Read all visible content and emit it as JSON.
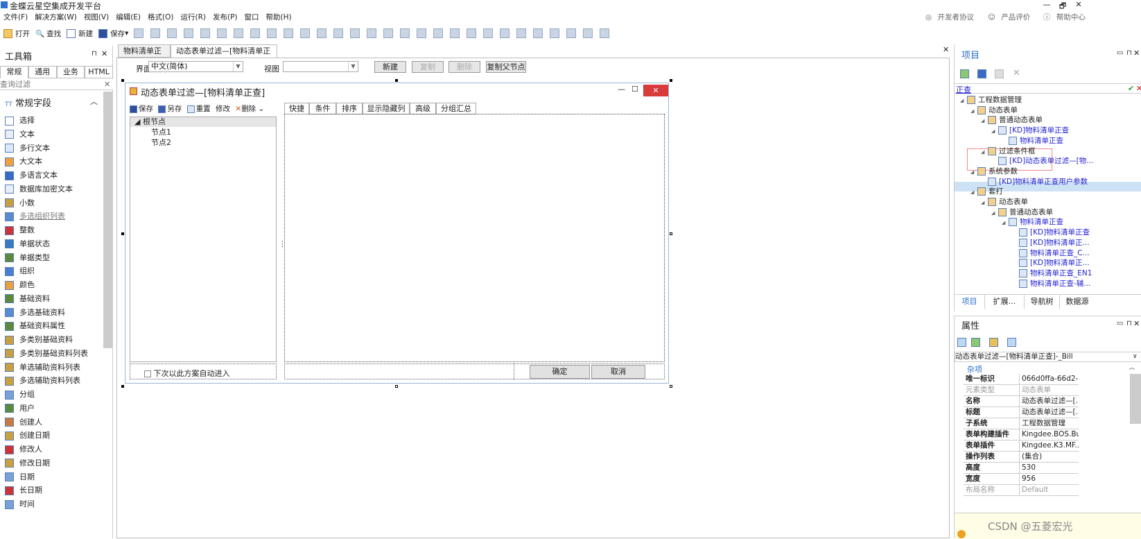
{
  "app": {
    "title": "金蝶云星空集成开发平台",
    "window_controls": [
      "—",
      "🗗",
      "✕"
    ]
  },
  "menu": {
    "items": [
      "文件(F)",
      "解决方案(W)",
      "视图(V)",
      "编辑(E)",
      "格式(O)",
      "运行(R)",
      "发布(P)",
      "窗口",
      "帮助(H)"
    ],
    "right": [
      "开发者协议",
      "产品评价",
      "帮助中心"
    ]
  },
  "toolbar": {
    "open": "打开",
    "find": "查找",
    "new": "新建",
    "save": "保存"
  },
  "toolbox": {
    "title": "工具箱",
    "tabs": [
      "常规",
      "通用",
      "业务",
      "HTML"
    ],
    "filter_placeholder": "查询过滤",
    "section": "常规字段",
    "items": [
      "选择",
      "文本",
      "多行文本",
      "大文本",
      "多语言文本",
      "数据库加密文本",
      "小数",
      "多选组织列表",
      "整数",
      "单据状态",
      "单据类型",
      "组织",
      "颜色",
      "基础资料",
      "多选基础资料",
      "基础资料属性",
      "多类别基础资料",
      "多类别基础资料列表",
      "单选辅助资料列表",
      "多选辅助资料列表",
      "分组",
      "用户",
      "创建人",
      "创建日期",
      "修改人",
      "修改日期",
      "日期",
      "长日期",
      "时间"
    ]
  },
  "doc_tabs": [
    "物料清单正查",
    "动态表单过滤—[物料清单正查]"
  ],
  "designer_bar": {
    "lang_label": "界面语言",
    "lang_value": "中文(简体)",
    "view_label": "视图",
    "view_value": "",
    "new": "新建",
    "copy": "复制",
    "delete": "删除",
    "copy_parent": "复制父节点"
  },
  "form": {
    "title": "动态表单过滤—[物料清单正查]",
    "toolbar": [
      "保存",
      "另存",
      "重置",
      "修改",
      "删除"
    ],
    "tree": {
      "root": "根节点",
      "children": [
        "节点1",
        "节点2"
      ]
    },
    "auto_enter": "下次以此方案自动进入",
    "tabs": [
      "快捷",
      "条件",
      "排序",
      "显示隐藏列",
      "高级",
      "分组汇总"
    ],
    "ok": "确定",
    "cancel": "取消"
  },
  "project": {
    "title": "项目",
    "filter": "正查",
    "tree": [
      {
        "label": "工程数据管理",
        "level": 0,
        "blue": false
      },
      {
        "label": "动态表单",
        "level": 1,
        "blue": false
      },
      {
        "label": "普通动态表单",
        "level": 2,
        "blue": false
      },
      {
        "label": "[KD]物料清单正查",
        "level": 3,
        "blue": true
      },
      {
        "label": "物料清单正查",
        "level": 4,
        "blue": true
      },
      {
        "label": "过滤条件框",
        "level": 2,
        "blue": false
      },
      {
        "label": "[KD]动态表单过滤—[物...",
        "level": 3,
        "blue": true
      },
      {
        "label": "系统参数",
        "level": 1,
        "blue": false
      },
      {
        "label": "[KD]物料清单正查用户参数",
        "level": 2,
        "blue": true
      },
      {
        "label": "套打",
        "level": 1,
        "blue": false,
        "selected": true
      },
      {
        "label": "动态表单",
        "level": 2,
        "blue": false
      },
      {
        "label": "普通动态表单",
        "level": 3,
        "blue": false
      },
      {
        "label": "物料清单正查",
        "level": 4,
        "blue": true
      },
      {
        "label": "[KD]物料清单正查",
        "level": 5,
        "blue": true
      },
      {
        "label": "[KD]物料清单正...",
        "level": 5,
        "blue": true
      },
      {
        "label": "物料清单正查_C...",
        "level": 5,
        "blue": true
      },
      {
        "label": "[KD]物料清单正...",
        "level": 5,
        "blue": true
      },
      {
        "label": "物料清单正查_EN1",
        "level": 5,
        "blue": true
      },
      {
        "label": "物料清单正查-辅...",
        "level": 5,
        "blue": true
      }
    ],
    "bottom_tabs": [
      "项目",
      "扩展...",
      "导航树",
      "数据源"
    ]
  },
  "properties": {
    "title": "属性",
    "object": "动态表单过滤—[物料清单正查]-_Bill",
    "category": "杂项",
    "rows": [
      {
        "k": "唯一标识",
        "v": "066d0ffa-66d2-...",
        "gray": false
      },
      {
        "k": "元素类型",
        "v": "动态表单",
        "gray": true
      },
      {
        "k": "名称",
        "v": "动态表单过滤—[...",
        "gray": false
      },
      {
        "k": "标题",
        "v": "动态表单过滤—[...",
        "gray": false
      },
      {
        "k": "子系统",
        "v": "工程数据管理",
        "gray": false
      },
      {
        "k": "表单构建插件",
        "v": "Kingdee.BOS.Bu...",
        "gray": false
      },
      {
        "k": "表单插件",
        "v": "Kingdee.K3.MF...",
        "gray": false
      },
      {
        "k": "操作列表",
        "v": "(集合)",
        "gray": false
      },
      {
        "k": "高度",
        "v": "530",
        "gray": false
      },
      {
        "k": "宽度",
        "v": "956",
        "gray": false
      },
      {
        "k": "布局名称",
        "v": "Default",
        "gray": true
      }
    ]
  },
  "watermark": "CSDN @五菱宏光"
}
